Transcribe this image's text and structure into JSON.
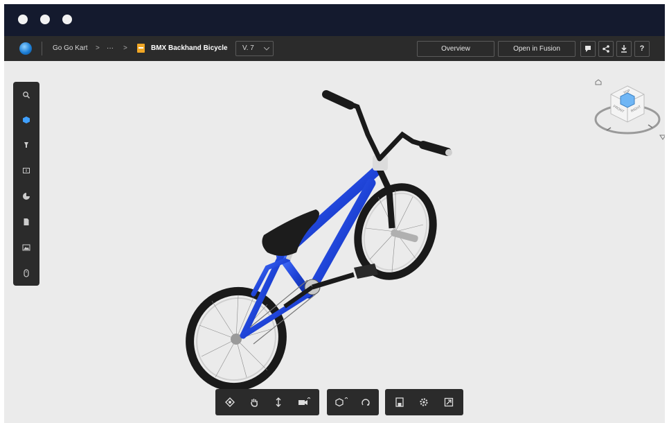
{
  "breadcrumb": {
    "project": "Go Go Kart",
    "ellipsis": "···",
    "separator": ">",
    "file_name": "BMX Backhand Bicycle",
    "version": "V. 7"
  },
  "header": {
    "overview_label": "Overview",
    "open_label": "Open in Fusion",
    "help_label": "?"
  },
  "icons": {
    "app_logo": "fusion-logo-icon",
    "file": "design-file-icon",
    "comment": "comment-icon",
    "share": "share-icon",
    "download": "download-icon"
  },
  "sidebar": {
    "items": [
      {
        "name": "search-icon"
      },
      {
        "name": "model-browser-icon",
        "active": true
      },
      {
        "name": "markup-icon"
      },
      {
        "name": "section-icon"
      },
      {
        "name": "explode-icon"
      },
      {
        "name": "document-icon"
      },
      {
        "name": "render-icon"
      },
      {
        "name": "info-icon"
      }
    ]
  },
  "viewcube": {
    "face_top": "TOP",
    "face_front": "FRONT",
    "face_right": "RIGHT"
  },
  "bottom_toolbar": {
    "groups": [
      [
        "orbit-icon",
        "pan-icon",
        "zoom-icon",
        "camera-icon"
      ],
      [
        "explode-model-icon",
        "reset-icon"
      ],
      [
        "save-view-icon",
        "settings-icon",
        "fullscreen-icon"
      ]
    ]
  },
  "colors": {
    "title_bar": "#141a2e",
    "toolbar": "#2b2b2b",
    "viewport": "#ebebeb",
    "frame_blue": "#1f44d8",
    "active_blue": "#3fa0ff",
    "file_orange": "#f0a624"
  }
}
